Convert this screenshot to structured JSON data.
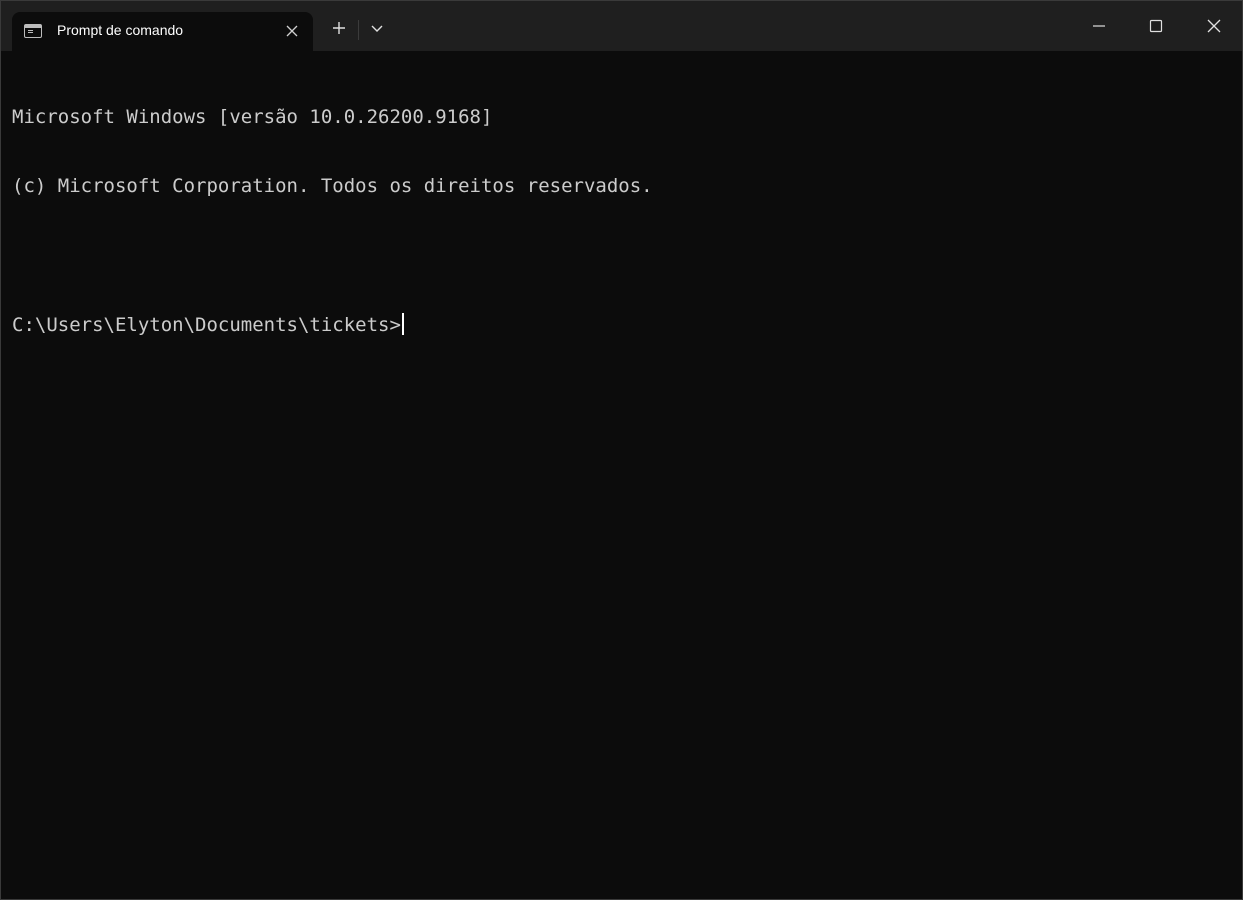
{
  "tab": {
    "title": "Prompt de comando",
    "icon": "command-prompt-icon"
  },
  "titlebar": {
    "new_tab_icon": "plus-icon",
    "dropdown_icon": "chevron-down-icon",
    "minimize_icon": "minimize-icon",
    "maximize_icon": "maximize-icon",
    "close_icon": "close-icon"
  },
  "terminal": {
    "lines": [
      "Microsoft Windows [versão 10.0.26200.9168]",
      "(c) Microsoft Corporation. Todos os direitos reservados.",
      "",
      "C:\\Users\\Elyton\\Documents\\tickets>"
    ]
  },
  "colors": {
    "background": "#0c0c0c",
    "titlebar": "#1f1f1f",
    "text": "#cccccc"
  }
}
